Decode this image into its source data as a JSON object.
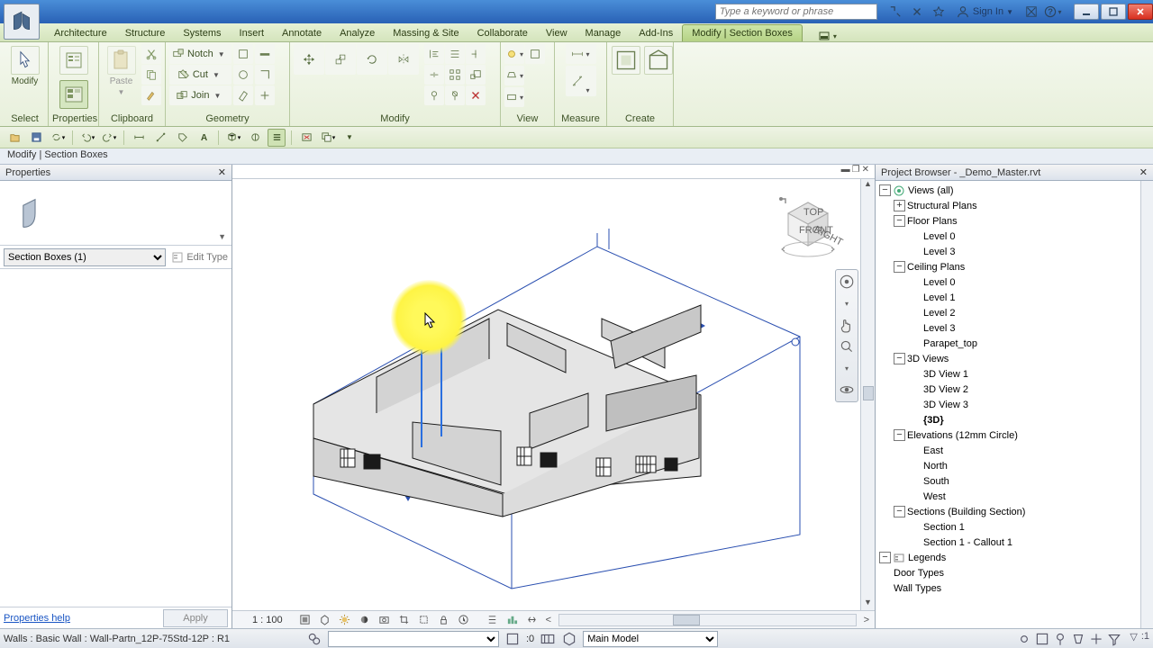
{
  "titlebar": {
    "search_placeholder": "Type a keyword or phrase",
    "signin": "Sign In"
  },
  "tabs": [
    "Architecture",
    "Structure",
    "Systems",
    "Insert",
    "Annotate",
    "Analyze",
    "Massing & Site",
    "Collaborate",
    "View",
    "Manage",
    "Add-Ins",
    "Modify | Section Boxes"
  ],
  "ribbon": {
    "select": {
      "modify": "Modify",
      "title": "Select"
    },
    "properties": {
      "title": "Properties"
    },
    "clipboard": {
      "paste": "Paste",
      "title": "Clipboard"
    },
    "geometry": {
      "notch": "Notch",
      "cut": "Cut",
      "join": "Join",
      "title": "Geometry"
    },
    "modify": {
      "title": "Modify"
    },
    "view": {
      "title": "View"
    },
    "measure": {
      "title": "Measure"
    },
    "create": {
      "title": "Create"
    }
  },
  "context_label": "Modify | Section Boxes",
  "properties": {
    "title": "Properties",
    "selector": "Section Boxes (1)",
    "edit_type": "Edit Type",
    "help": "Properties help",
    "apply": "Apply"
  },
  "canvas": {
    "scale": "1 : 100"
  },
  "browser": {
    "title": "Project Browser - _Demo_Master.rvt",
    "tree": [
      {
        "l": 0,
        "tw": "−",
        "icon": "views",
        "label": "Views (all)"
      },
      {
        "l": 1,
        "tw": "+",
        "label": "Structural Plans"
      },
      {
        "l": 1,
        "tw": "−",
        "label": "Floor Plans"
      },
      {
        "l": 2,
        "label": "Level 0"
      },
      {
        "l": 2,
        "label": "Level 3"
      },
      {
        "l": 1,
        "tw": "−",
        "label": "Ceiling Plans"
      },
      {
        "l": 2,
        "label": "Level 0"
      },
      {
        "l": 2,
        "label": "Level 1"
      },
      {
        "l": 2,
        "label": "Level 2"
      },
      {
        "l": 2,
        "label": "Level 3"
      },
      {
        "l": 2,
        "label": "Parapet_top"
      },
      {
        "l": 1,
        "tw": "−",
        "label": "3D Views"
      },
      {
        "l": 2,
        "label": "3D View 1"
      },
      {
        "l": 2,
        "label": "3D View 2"
      },
      {
        "l": 2,
        "label": "3D View 3"
      },
      {
        "l": 2,
        "label": "{3D}",
        "sel": true
      },
      {
        "l": 1,
        "tw": "−",
        "label": "Elevations (12mm Circle)"
      },
      {
        "l": 2,
        "label": "East"
      },
      {
        "l": 2,
        "label": "North"
      },
      {
        "l": 2,
        "label": "South"
      },
      {
        "l": 2,
        "label": "West"
      },
      {
        "l": 1,
        "tw": "−",
        "label": "Sections (Building Section)"
      },
      {
        "l": 2,
        "label": "Section 1"
      },
      {
        "l": 2,
        "label": "Section 1 - Callout 1"
      },
      {
        "l": 0,
        "tw": "−",
        "icon": "legend",
        "label": "Legends"
      },
      {
        "l": 1,
        "label": "Door Types"
      },
      {
        "l": 1,
        "label": "Wall Types"
      }
    ]
  },
  "status": {
    "hint": "Walls : Basic Wall : Wall-Partn_12P-75Std-12P : R1",
    "zero": ":0",
    "workset": "Main Model"
  }
}
